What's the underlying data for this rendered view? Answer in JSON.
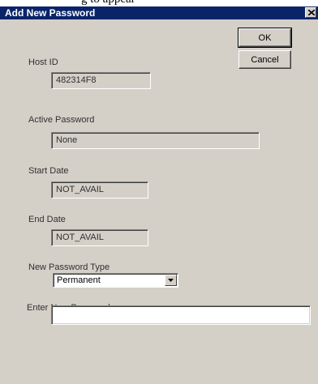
{
  "partial_caption": "g to appear",
  "window": {
    "title": "Add New Password"
  },
  "buttons": {
    "ok": "OK",
    "cancel": "Cancel"
  },
  "fields": {
    "host_id": {
      "label": "Host ID",
      "value": "482314F8"
    },
    "active_password": {
      "label": "Active Password",
      "value": "None"
    },
    "start_date": {
      "label": "Start Date",
      "value": "NOT_AVAIL"
    },
    "end_date": {
      "label": "End Date",
      "value": "NOT_AVAIL"
    },
    "new_password_type": {
      "label": "New Password Type",
      "value": "Permanent"
    },
    "new_password": {
      "label": "Enter New Password",
      "value": ""
    }
  },
  "icons": {
    "close": "close-icon",
    "dropdown": "chevron-down-icon"
  },
  "colors": {
    "titlebar": "#0a246a",
    "dialog_bg": "#d4d0c8"
  }
}
